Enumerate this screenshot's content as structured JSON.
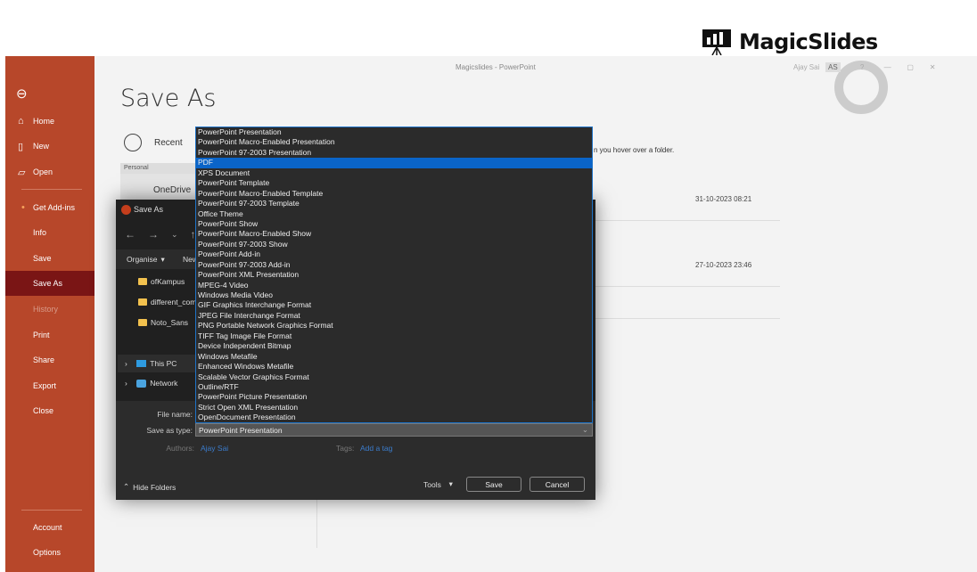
{
  "logo": {
    "text": "MagicSlides"
  },
  "window": {
    "title": "Magicslides  -  PowerPoint",
    "account": "Ajay Sai",
    "initials": "AS"
  },
  "sidebar": {
    "items": [
      {
        "label": "Home",
        "icon": "home-icon"
      },
      {
        "label": "New",
        "icon": "new-icon"
      },
      {
        "label": "Open",
        "icon": "open-icon"
      },
      {
        "label": "Get Add-ins"
      },
      {
        "label": "Info"
      },
      {
        "label": "Save"
      },
      {
        "label": "Save As",
        "selected": true
      },
      {
        "label": "History",
        "disabled": true
      },
      {
        "label": "Print"
      },
      {
        "label": "Share"
      },
      {
        "label": "Export"
      },
      {
        "label": "Close"
      },
      {
        "label": "Account"
      },
      {
        "label": "Options"
      }
    ]
  },
  "main": {
    "title": "Save As",
    "recent": "Recent",
    "personal": "Personal",
    "onedrive": "OneDrive",
    "hint": "n you hover over a folder.",
    "dates": [
      "31-10-2023 08:21",
      "27-10-2023 23:46"
    ]
  },
  "dialog": {
    "title": "Save As",
    "organise": "Organise",
    "new": "New",
    "folders": [
      "ofKampus",
      "different_com",
      "Noto_Sans"
    ],
    "nav": [
      "This PC",
      "Network"
    ],
    "file_name_label": "File name:",
    "type_label": "Save as type:",
    "type_value": "PowerPoint Presentation",
    "authors_label": "Authors:",
    "authors": "Ajay Sai",
    "tags_label": "Tags:",
    "tags": "Add a tag",
    "hide_folders": "Hide Folders",
    "tools": "Tools",
    "save": "Save",
    "cancel": "Cancel",
    "types": [
      "PowerPoint Presentation",
      "PowerPoint Macro-Enabled Presentation",
      "PowerPoint 97-2003 Presentation",
      "PDF",
      "XPS Document",
      "PowerPoint Template",
      "PowerPoint Macro-Enabled Template",
      "PowerPoint 97-2003 Template",
      "Office Theme",
      "PowerPoint Show",
      "PowerPoint Macro-Enabled Show",
      "PowerPoint 97-2003 Show",
      "PowerPoint Add-in",
      "PowerPoint 97-2003 Add-in",
      "PowerPoint XML Presentation",
      "MPEG-4 Video",
      "Windows Media Video",
      "GIF Graphics Interchange Format",
      "JPEG File Interchange Format",
      "PNG Portable Network Graphics Format",
      "TIFF Tag Image File Format",
      "Device Independent Bitmap",
      "Windows Metafile",
      "Enhanced Windows Metafile",
      "Scalable Vector Graphics Format",
      "Outline/RTF",
      "PowerPoint Picture Presentation",
      "Strict Open XML Presentation",
      "OpenDocument Presentation"
    ],
    "highlighted": "PDF"
  },
  "colors": {
    "sidebar": "#b7472a",
    "selected": "#7a1515",
    "highlight": "#0a64c8"
  }
}
